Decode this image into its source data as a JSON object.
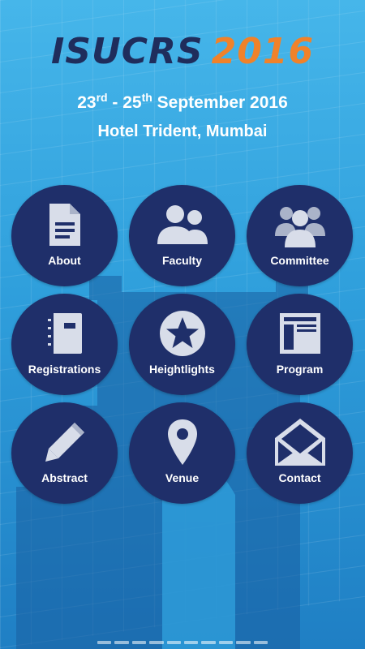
{
  "header": {
    "logo_name": "ISUCRS",
    "logo_year": "2016",
    "date_day1": "23",
    "date_sup1": "rd",
    "date_sep": " - 25",
    "date_sup2": "th",
    "date_rest": " September 2016",
    "venue": "Hotel Trident, Mumbai"
  },
  "tiles": [
    {
      "label": "About",
      "icon": "document-icon"
    },
    {
      "label": "Faculty",
      "icon": "people-icon"
    },
    {
      "label": "Committee",
      "icon": "group-icon"
    },
    {
      "label": "Registrations",
      "icon": "notebook-icon"
    },
    {
      "label": "Heightlights",
      "icon": "star-icon"
    },
    {
      "label": "Program",
      "icon": "layout-icon"
    },
    {
      "label": "Abstract",
      "icon": "pencil-icon"
    },
    {
      "label": "Venue",
      "icon": "location-pin-icon"
    },
    {
      "label": "Contact",
      "icon": "envelope-icon"
    }
  ],
  "colors": {
    "tile_bg": "#1f2f6a",
    "logo_name": "#1f2d5c",
    "logo_year": "#f0822a",
    "icon_fill": "#d8dde9"
  }
}
